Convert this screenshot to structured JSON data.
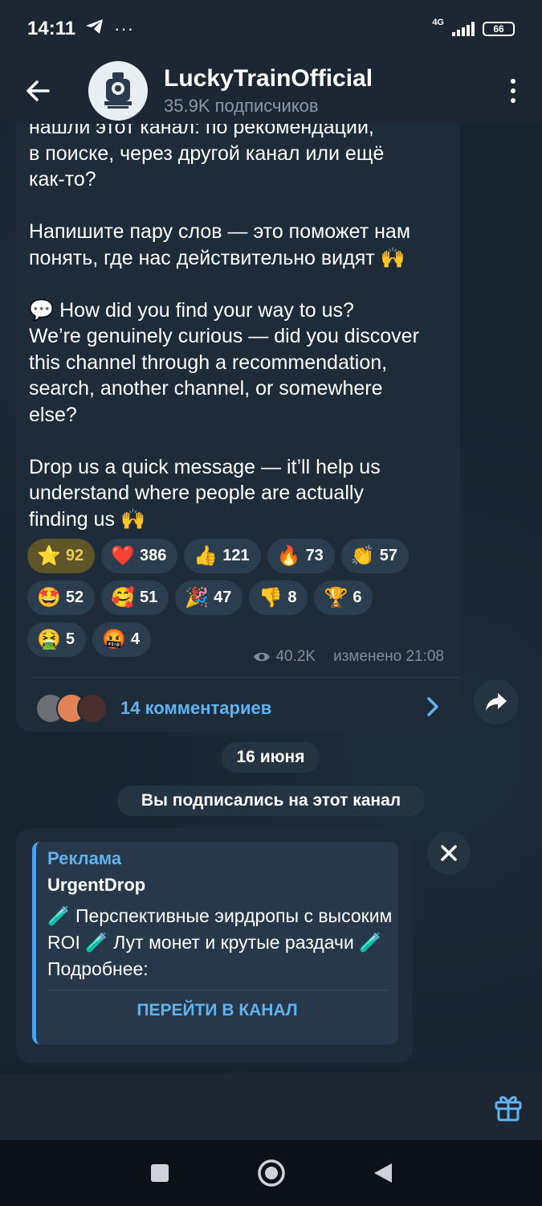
{
  "status_bar": {
    "time": "14:11",
    "telegram_icon": "paper-plane-icon",
    "more_notifications": "···",
    "network": "4G",
    "battery": "66"
  },
  "header": {
    "title": "LuckyTrainOfficial",
    "subtitle": "35.9K подписчиков",
    "back_icon": "arrow-left-icon",
    "menu_icon": "kebab-menu-icon"
  },
  "post": {
    "text": "нашли этот канал: по рекомендации,\nв поиске, через другой канал или ещё\nкак-то?\n\nНапишите пару слов — это поможет нам\nпонять, где нас действительно видят 🙌\n\n💬 How did you find your way to us?\nWe’re genuinely curious — did you discover\nthis channel through a recommendation,\nsearch, another channel, or somewhere\nelse?\n\nDrop us a quick message — it’ll help us\nunderstand where people are actually\nfinding us 🙌",
    "reactions": [
      {
        "emoji": "⭐",
        "count": "92",
        "active": true
      },
      {
        "emoji": "❤️",
        "count": "386"
      },
      {
        "emoji": "👍",
        "count": "121"
      },
      {
        "emoji": "🔥",
        "count": "73"
      },
      {
        "emoji": "👏",
        "count": "57"
      },
      {
        "emoji": "🤩",
        "count": "52"
      },
      {
        "emoji": "🥰",
        "count": "51"
      },
      {
        "emoji": "🎉",
        "count": "47"
      },
      {
        "emoji": "👎",
        "count": "8"
      },
      {
        "emoji": "🏆",
        "count": "6"
      },
      {
        "emoji": "🤮",
        "count": "5"
      },
      {
        "emoji": "🤬",
        "count": "4"
      }
    ],
    "views": "40.2K",
    "edited": "изменено 21:08",
    "comments_label": "14 комментариев"
  },
  "date_pill": "16 июня",
  "service_message": "Вы подписались на этот канал",
  "ad": {
    "label": "Реклама",
    "name": "UrgentDrop",
    "text": "🧪 Перспективные эирдропы с высоким ROI 🧪 Лут монет и крутые раздачи 🧪 Подробнее:",
    "button": "ПЕРЕЙТИ В КАНАЛ"
  },
  "colors": {
    "accent": "#62b2f0",
    "bubble": "#1e2c3a",
    "header": "#1c2733"
  }
}
